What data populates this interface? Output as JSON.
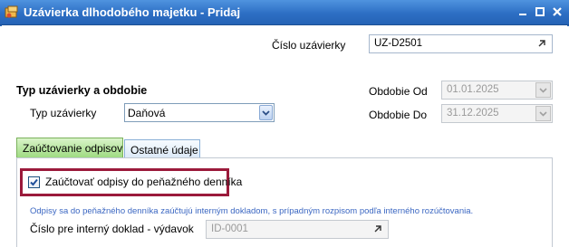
{
  "window": {
    "title": "Uzávierka dlhodobého majetku - Pridaj"
  },
  "header": {
    "cislo_label": "Číslo uzávierky",
    "cislo_value": "UZ-D2501"
  },
  "section": {
    "heading": "Typ uzávierky a obdobie",
    "typ_label": "Typ uzávierky",
    "typ_value": "Daňová",
    "od_label": "Obdobie Od",
    "od_value": "01.01.2025",
    "do_label": "Obdobie Do",
    "do_value": "31.12.2025"
  },
  "tabs": [
    {
      "label": "Zaúčtovanie odpisov",
      "active": true
    },
    {
      "label": "Ostatné údaje",
      "active": false
    }
  ],
  "panel": {
    "checkbox_label": "Zaúčtovať odpisy do peňažného denníka",
    "checkbox_checked": true,
    "hint": "Odpisy sa do peňažného denníka zaúčtujú interným dokladom, s prípadným rozpisom podľa interného rozúčtovania.",
    "doklad_label": "Číslo pre interný doklad - výdavok",
    "doklad_value": "ID-0001"
  },
  "colors": {
    "titlebar": "#2d6fc4",
    "active_tab": "#9fdb82",
    "highlight_border": "#9b1a3b",
    "hint_text": "#3b67c2"
  }
}
